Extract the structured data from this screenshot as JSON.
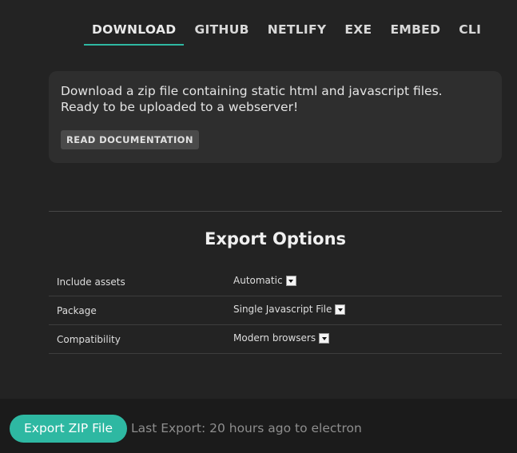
{
  "tabs": [
    {
      "label": "DOWNLOAD",
      "active": true
    },
    {
      "label": "GITHUB",
      "active": false
    },
    {
      "label": "NETLIFY",
      "active": false
    },
    {
      "label": "EXE",
      "active": false
    },
    {
      "label": "EMBED",
      "active": false
    },
    {
      "label": "CLI",
      "active": false
    }
  ],
  "info": {
    "line1": "Download a zip file containing static html and javascript files.",
    "line2": "Ready to be uploaded to a webserver!",
    "doc_button": "READ DOCUMENTATION"
  },
  "export_options": {
    "title": "Export Options",
    "rows": [
      {
        "label": "Include assets",
        "value": "Automatic",
        "icon": "dropdown-arrow-icon"
      },
      {
        "label": "Package",
        "value": "Single Javascript File",
        "icon": "dropdown-arrow-icon"
      },
      {
        "label": "Compatibility",
        "value": "Modern browsers",
        "icon": "dropdown-arrow-icon"
      }
    ]
  },
  "footer": {
    "export_button": "Export ZIP File",
    "last_export": "Last Export: 20 hours ago to electron"
  },
  "colors": {
    "accent": "#2eb8a2",
    "background": "#232323",
    "panel": "#2e2e2e",
    "footer": "#1b1b1b"
  }
}
